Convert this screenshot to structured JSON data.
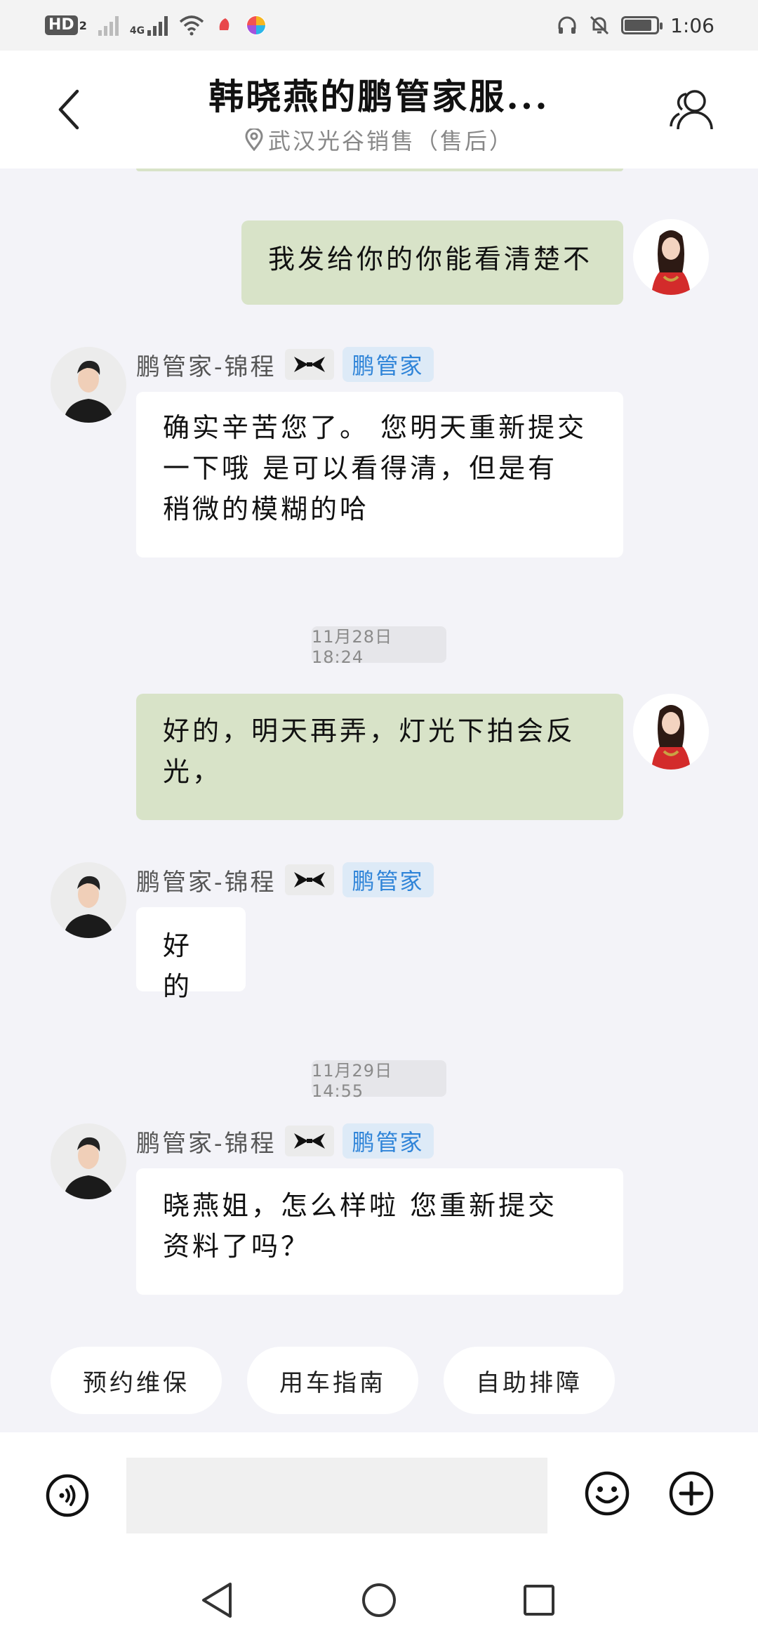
{
  "status_bar": {
    "hd_label": "HD",
    "hd_sub": "2",
    "net_label": "4G",
    "time": "1:06",
    "battery_level": 0.85
  },
  "header": {
    "title": "韩晓燕的鹏管家服...",
    "location": "武汉光谷销售（售后）"
  },
  "messages": [
    {
      "id": "m1",
      "direction": "out",
      "text": "我发给你的你能看清楚不"
    },
    {
      "id": "m2",
      "direction": "in",
      "sender": "鹏管家-锦程",
      "badge": "鹏管家",
      "lines": [
        "确实辛苦您了。 您明天重新提交",
        "一下哦 是可以看得清，但是有",
        "稍微的模糊的哈"
      ]
    },
    {
      "id": "t1",
      "type": "timestamp",
      "text": "11月28日 18:24"
    },
    {
      "id": "m3",
      "direction": "out",
      "lines": [
        "好的，明天再弄，灯光下拍会反",
        "光，"
      ]
    },
    {
      "id": "m4",
      "direction": "in",
      "sender": "鹏管家-锦程",
      "badge": "鹏管家",
      "text": "好的"
    },
    {
      "id": "t2",
      "type": "timestamp",
      "text": "11月29日 14:55"
    },
    {
      "id": "m5",
      "direction": "in",
      "sender": "鹏管家-锦程",
      "badge": "鹏管家",
      "lines": [
        "晓燕姐，怎么样啦 您重新提交",
        "资料了吗？"
      ]
    }
  ],
  "quick_actions": [
    "预约维保",
    "用车指南",
    "自助排障"
  ],
  "input": {
    "value": "",
    "placeholder": ""
  },
  "colors": {
    "outgoing_bubble": "#d8e3c8",
    "incoming_bubble": "#ffffff",
    "badge_text": "#2f84d8",
    "badge_bg": "#ddeaf7",
    "background": "#f3f3f8"
  },
  "icons": {
    "back": "chevron-left-icon",
    "profile": "user-group-icon",
    "location": "location-pin-icon",
    "tag": "bow-tie-icon",
    "voice": "voice-icon",
    "emoji": "smile-icon",
    "plus": "plus-circle-icon"
  }
}
